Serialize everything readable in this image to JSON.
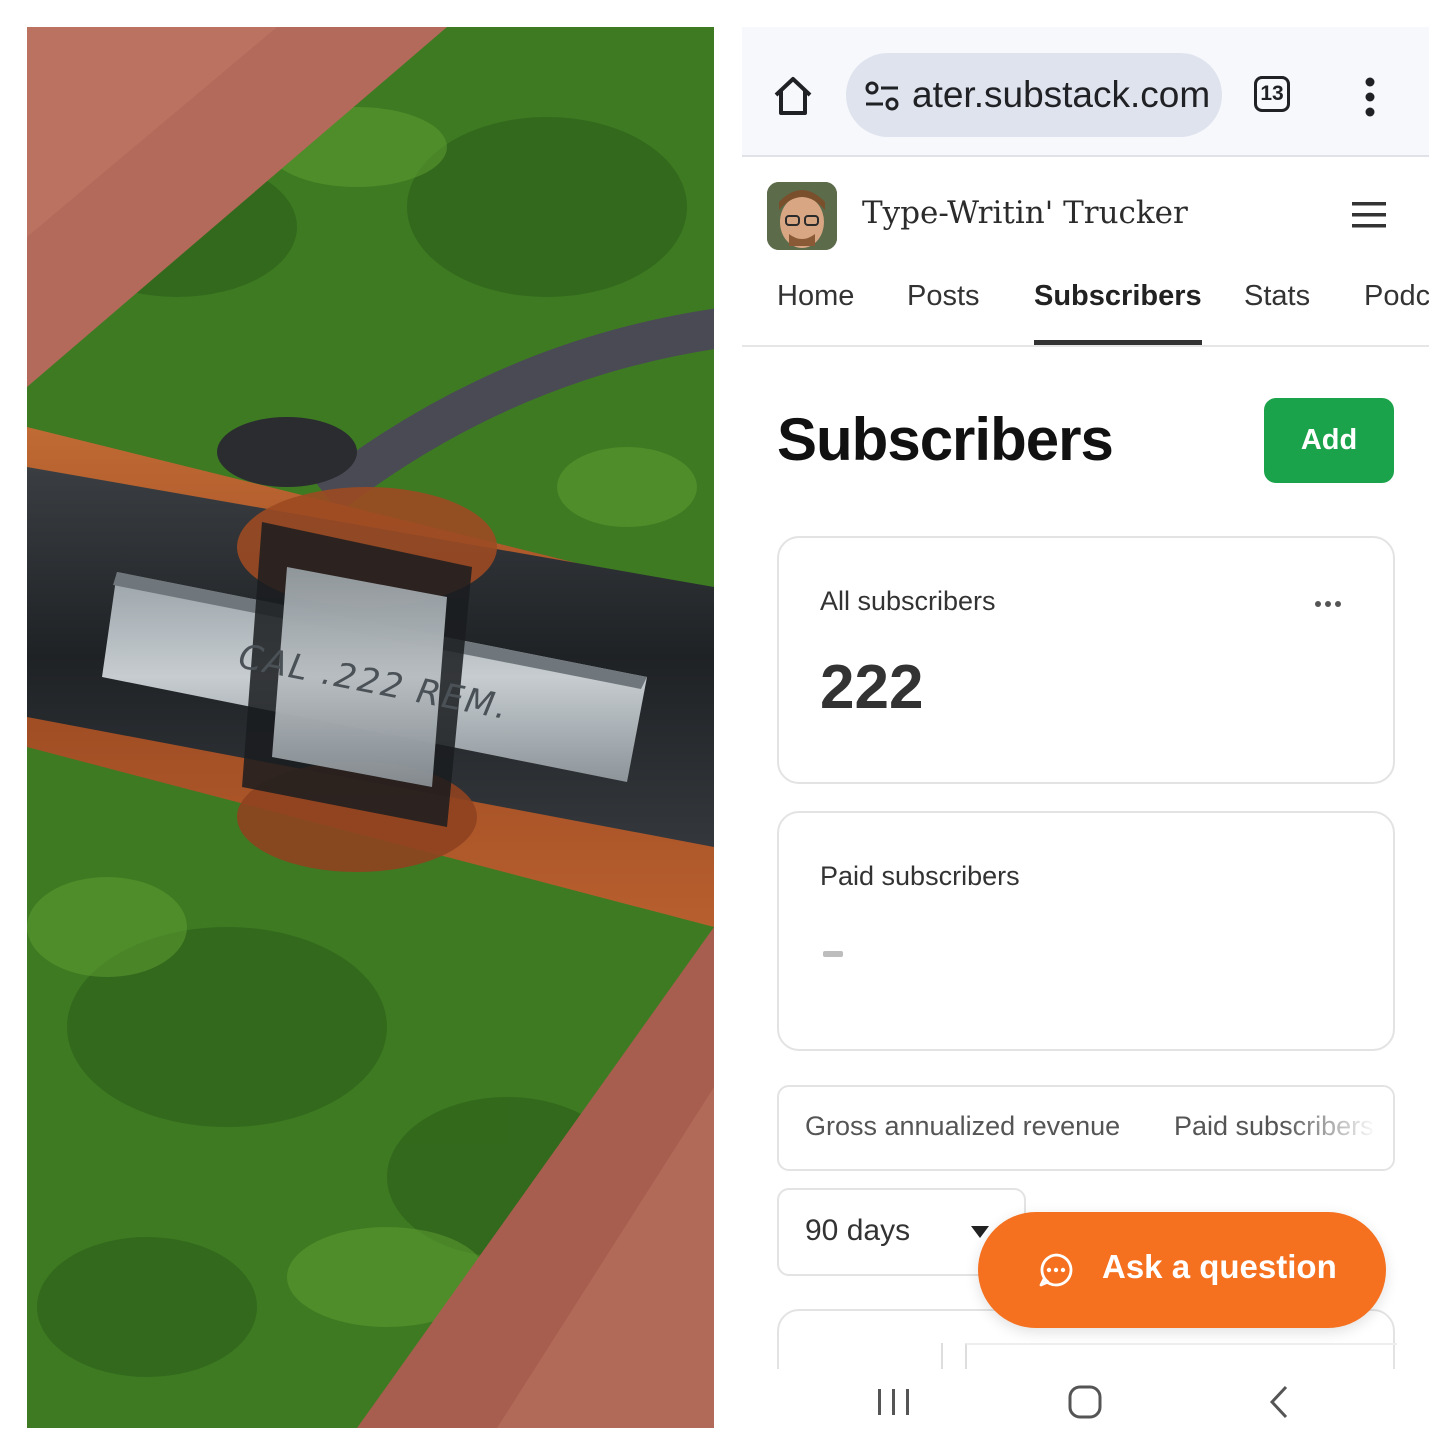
{
  "photo": {
    "engraving": "CAL .222 REM.",
    "colors": {
      "grass": "#3d7a22",
      "wood": "#a4522a",
      "steel": "#2a2d30",
      "brick": "#b36a5a"
    }
  },
  "browser": {
    "url": "ater.substack.com",
    "tab_count": "13"
  },
  "publication": {
    "name": "Type-Writin' Trucker"
  },
  "nav": {
    "tabs": [
      {
        "label": "Home"
      },
      {
        "label": "Posts"
      },
      {
        "label": "Subscribers"
      },
      {
        "label": "Stats"
      },
      {
        "label": "Podcast"
      }
    ],
    "active": "Subscribers"
  },
  "page": {
    "title": "Subscribers",
    "add_label": "Add"
  },
  "cards": {
    "all": {
      "label": "All subscribers",
      "value": "222"
    },
    "paid": {
      "label": "Paid subscribers"
    }
  },
  "metric_tabs": [
    {
      "label": "Gross annualized revenue"
    },
    {
      "label": "Paid subscribers"
    }
  ],
  "range": {
    "selected": "90 days"
  },
  "fab": {
    "label": "Ask a question"
  },
  "colors": {
    "accent_green": "#1aa34a",
    "accent_orange": "#f5701f"
  }
}
